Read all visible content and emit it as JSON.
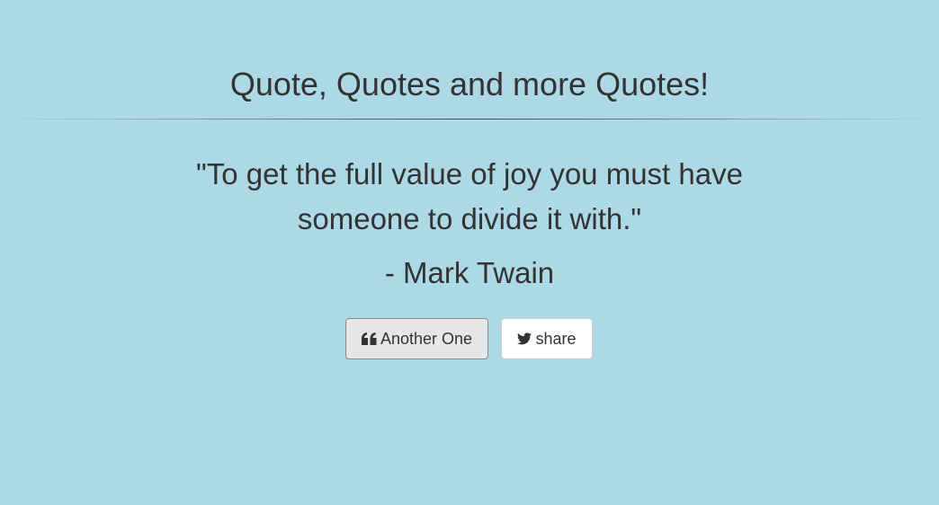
{
  "header": {
    "title": "Quote, Quotes and more Quotes!"
  },
  "quote": {
    "text": "\"To get the full value of joy you must have someone to divide it with.\"",
    "author": "- Mark Twain"
  },
  "actions": {
    "another_label": "Another One",
    "another_icon": "quote-left-icon",
    "share_label": "share",
    "share_icon": "twitter-icon"
  },
  "colors": {
    "background": "#add8e6",
    "text": "#333333",
    "button_active_bg": "#e6e6e6",
    "button_bg": "#ffffff"
  }
}
